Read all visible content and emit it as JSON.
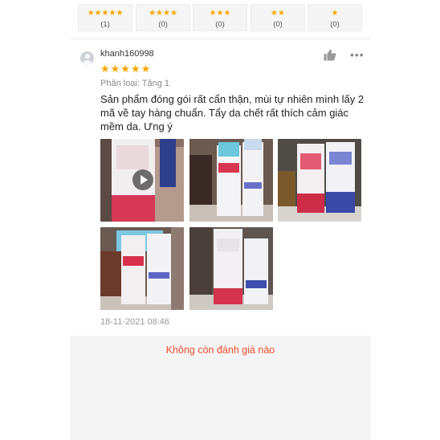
{
  "rating_filters": [
    {
      "stars": "★★★★★",
      "count": "(1)"
    },
    {
      "stars": "★★★★",
      "count": "(0)"
    },
    {
      "stars": "★★★",
      "count": "(0)"
    },
    {
      "stars": "★★",
      "count": "(0)"
    },
    {
      "stars": "★",
      "count": "(0)"
    }
  ],
  "review": {
    "username": "khanh160998",
    "rating_stars": "★★★★★",
    "rating": 5,
    "variation": "Phân loại: Tặng 1",
    "comment": "Sản phẩm đóng gói rất cẩn thận, mùi tự nhiên mình lấy 2 mã về tay hàng chuẩn. Tẩy da chết rất thích cảm giác mềm da. Ưng ý",
    "date": "18-11-2021 08:46",
    "media": [
      {
        "kind": "video",
        "icon": "play-icon"
      },
      {
        "kind": "photo"
      },
      {
        "kind": "photo"
      },
      {
        "kind": "photo"
      },
      {
        "kind": "photo"
      }
    ],
    "icons": {
      "avatar": "user-avatar-icon",
      "like": "thumbs-up-icon",
      "more": "more-options-icon"
    }
  },
  "footer": {
    "end_message": "Không còn đánh giá nào"
  },
  "colors": {
    "star": "#f6a700",
    "accent": "#ee4d2d",
    "panel": "#f5f5f5"
  }
}
